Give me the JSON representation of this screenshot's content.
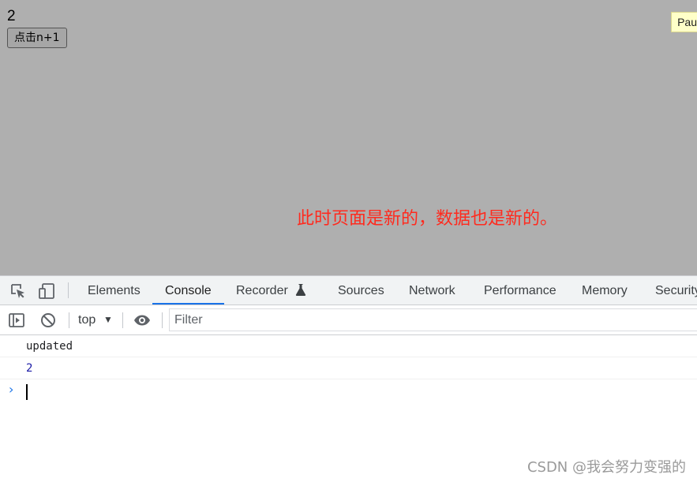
{
  "page": {
    "counter_value": "2",
    "increment_button_label": "点击n+1",
    "paused_badge_text": "Pau",
    "annotation_text": "此时页面是新的，数据也是新的。"
  },
  "devtools": {
    "tabs": [
      {
        "label": "Elements",
        "active": false
      },
      {
        "label": "Console",
        "active": true
      },
      {
        "label": "Recorder",
        "active": false,
        "icon": "flask-icon"
      },
      {
        "label": "Sources",
        "active": false
      },
      {
        "label": "Network",
        "active": false
      },
      {
        "label": "Performance",
        "active": false
      },
      {
        "label": "Memory",
        "active": false
      },
      {
        "label": "Security",
        "active": false
      }
    ],
    "toolbar": {
      "context": "top",
      "filter_placeholder": "Filter"
    },
    "messages": [
      {
        "text": "updated",
        "type": "string"
      },
      {
        "text": "2",
        "type": "number"
      }
    ]
  },
  "watermark": "CSDN @我会努力变强的",
  "colors": {
    "page_bg": "#afafaf",
    "annotation": "#ff2a1e",
    "active_tab_underline": "#1a73e8",
    "number_output": "#1a1aa6"
  }
}
